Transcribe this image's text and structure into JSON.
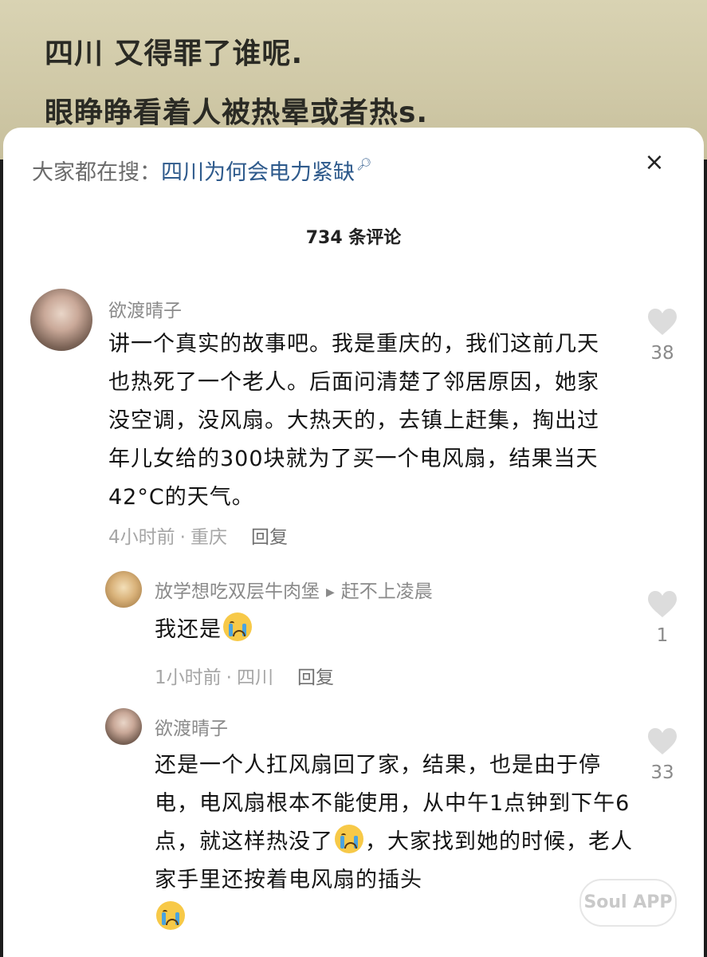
{
  "video": {
    "caption_line1": "四川 又得罪了谁呢.",
    "caption_line2": "眼睁睁看着人被热晕或者热s."
  },
  "search": {
    "label": "大家都在搜：",
    "link": "四川为何会电力紧缺"
  },
  "close": "×",
  "comments_count_title": "734 条评论",
  "comments": [
    {
      "user": "欲渡晴子",
      "text": "讲一个真实的故事吧。我是重庆的，我们这前几天也热死了一个老人。后面问清楚了邻居原因，她家没空调，没风扇。大热天的，去镇上赶集，掏出过年儿女给的300块就为了买一个电风扇，结果当天42°C的天气。",
      "time": "4小时前",
      "location": "重庆",
      "reply": "回复",
      "likes": "38"
    },
    {
      "user": "放学想吃双层牛肉堡",
      "reply_to": "赶不上凌晨",
      "text": "我还是",
      "time": "1小时前",
      "location": "四川",
      "reply": "回复",
      "likes": "1"
    },
    {
      "user": "欲渡晴子",
      "text_part1": "还是一个人扛风扇回了家，结果，也是由于停电，电风扇根本不能使用，从中午1点钟到下午6点，就这样热没了",
      "text_part2": "，大家找到她的时候，老人家手里还按着电风扇的插头",
      "likes": "33"
    }
  ],
  "watermark": "Soul APP"
}
